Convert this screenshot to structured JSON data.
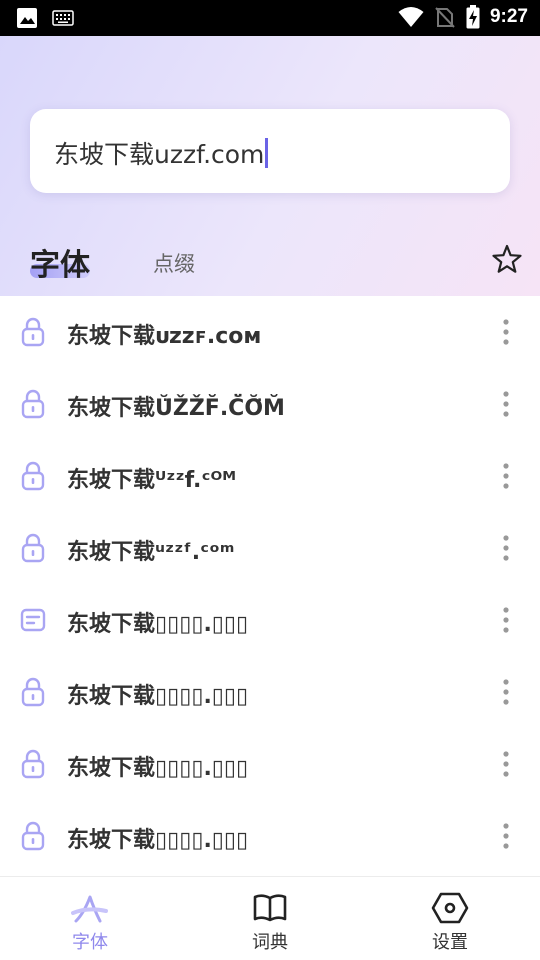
{
  "status_bar": {
    "time": "9:27",
    "left_icons": [
      "image-icon",
      "keyboard-icon"
    ],
    "right_icons": [
      "wifi-icon",
      "no-sim-icon",
      "battery-charging-icon"
    ]
  },
  "search": {
    "value": "东坡下载uzzf.com"
  },
  "tabs": {
    "font_label": "字体",
    "decor_label": "点缀",
    "active": "字体"
  },
  "list": {
    "items": [
      {
        "prefix": "东坡下载",
        "styled": "ᴜᴢᴢꜰ.ᴄᴏᴍ",
        "icon": "lock-icon"
      },
      {
        "prefix": "东坡下载",
        "styled": "Ŭ̈Ž̈Ž̈F̆.C̆̈Ŏ̈M̆",
        "icon": "lock-icon"
      },
      {
        "prefix": "东坡下载",
        "styled": "ᵁᶻᶻf.ᶜᴼᴹ",
        "icon": "lock-icon"
      },
      {
        "prefix": "东坡下载",
        "styled": "ᵘᶻᶻᶠ.ᶜᵒᵐ",
        "icon": "lock-icon"
      },
      {
        "prefix": "东坡下载",
        "styled": "▯▯▯▯.▯▯▯",
        "icon": "note-icon"
      },
      {
        "prefix": "东坡下载",
        "styled": "▯▯▯▯.▯▯▯",
        "icon": "lock-icon"
      },
      {
        "prefix": "东坡下载",
        "styled": "▯▯▯▯.▯▯▯",
        "icon": "lock-icon"
      },
      {
        "prefix": "东坡下载",
        "styled": "▯▯▯▯.▯▯▯",
        "icon": "lock-icon"
      }
    ]
  },
  "bottom_nav": [
    {
      "label": "字体",
      "icon": "font-a-icon",
      "active": true
    },
    {
      "label": "词典",
      "icon": "book-icon",
      "active": false
    },
    {
      "label": "设置",
      "icon": "settings-hexagon-icon",
      "active": false
    }
  ],
  "colors": {
    "accent": "#8f88ec",
    "icon_tint": "#a9a5f3",
    "text_primary": "#333333"
  }
}
